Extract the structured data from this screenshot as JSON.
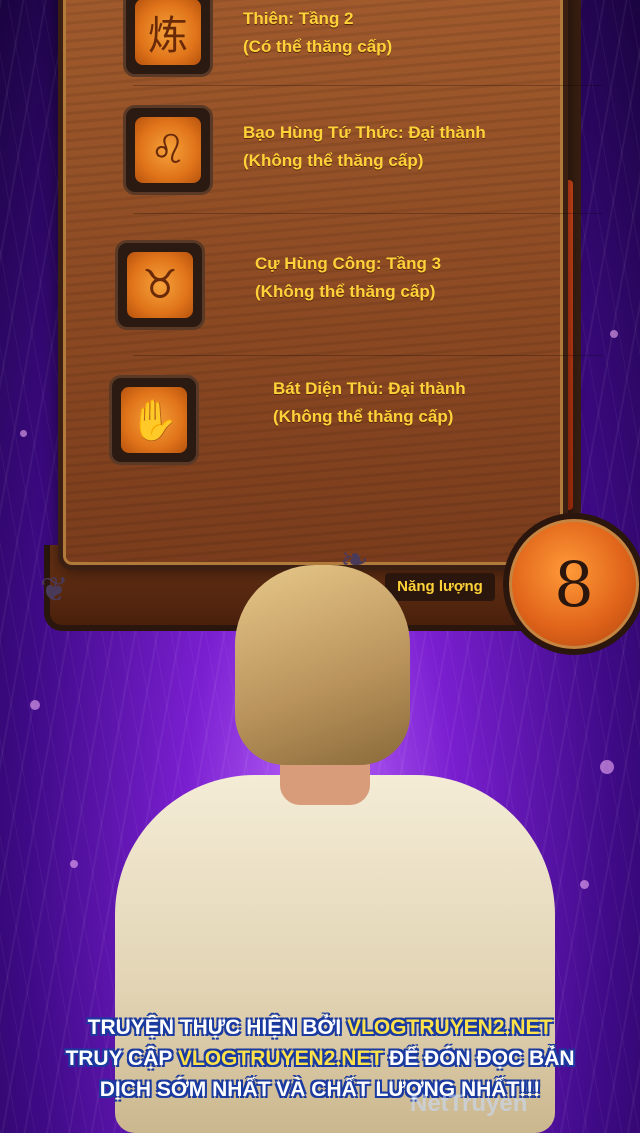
{
  "skills": [
    {
      "icon": "fire-rune-icon",
      "glyph": "炼",
      "line1": "Thiên: Tầng 2",
      "line2": "(Có thể thăng cấp)"
    },
    {
      "icon": "lion-icon",
      "glyph": "♌",
      "line1": "Bạo Hùng Tứ Thức: Đại thành",
      "line2": "(Không thể thăng cấp)"
    },
    {
      "icon": "bear-icon",
      "glyph": "♉",
      "line1": "Cự Hùng Công: Tầng 3",
      "line2": "(Không thể thăng cấp)"
    },
    {
      "icon": "hands-icon",
      "glyph": "✋",
      "line1": "Bát Diện Thủ: Đại thành",
      "line2": "(Không thể thăng cấp)"
    }
  ],
  "energy": {
    "label": "Năng lượng",
    "value": "8"
  },
  "banner": {
    "l1a": "TRUYỆN THỰC HIỆN BỞI ",
    "l1b": "VLOGTRUYEN2.NET",
    "l2a": "TRUY CẬP ",
    "l2b": "VLOGTRUYEN2.NET",
    "l2c": " ĐỂ ĐÓN ĐỌC BẢN",
    "l3": "DỊCH SỚM NHẤT VÀ CHẤT LƯỢNG NHẤT!!!"
  },
  "watermark": "NetTruyen",
  "colors": {
    "text_gold": "#ffd23a",
    "panel": "#8a4822",
    "bg": "#7a1fd0"
  }
}
